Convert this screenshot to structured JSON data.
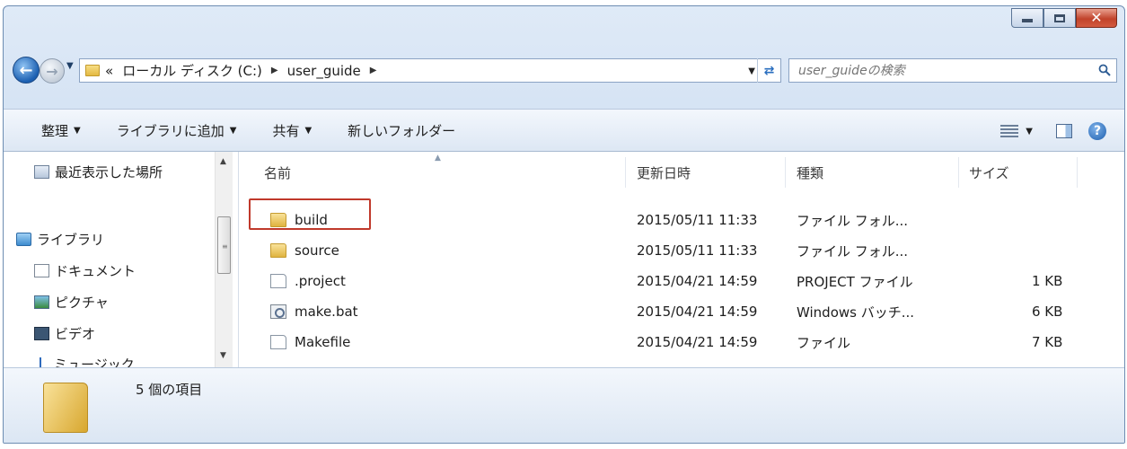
{
  "window": {
    "caption_close": "✕"
  },
  "address": {
    "prefix": "«",
    "crumbs": [
      "ローカル ディスク (C:)",
      "user_guide"
    ]
  },
  "search": {
    "placeholder": "user_guideの検索"
  },
  "toolbar": {
    "organize": "整理",
    "add_to_library": "ライブラリに追加",
    "share": "共有",
    "new_folder": "新しいフォルダー"
  },
  "nav": {
    "recent": "最近表示した場所",
    "library": "ライブラリ",
    "documents": "ドキュメント",
    "pictures": "ピクチャ",
    "videos": "ビデオ",
    "music": "ミュージック"
  },
  "columns": {
    "name": "名前",
    "modified": "更新日時",
    "type": "種類",
    "size": "サイズ"
  },
  "files": [
    {
      "name": "build",
      "modified": "2015/05/11 11:33",
      "type": "ファイル フォル...",
      "size": "",
      "icon": "folder-icon"
    },
    {
      "name": "source",
      "modified": "2015/05/11 11:33",
      "type": "ファイル フォル...",
      "size": "",
      "icon": "folder-icon"
    },
    {
      "name": ".project",
      "modified": "2015/04/21 14:59",
      "type": "PROJECT ファイル",
      "size": "1 KB",
      "icon": "file-icon"
    },
    {
      "name": "make.bat",
      "modified": "2015/04/21 14:59",
      "type": "Windows バッチ...",
      "size": "6 KB",
      "icon": "batch-file-icon"
    },
    {
      "name": "Makefile",
      "modified": "2015/04/21 14:59",
      "type": "ファイル",
      "size": "7 KB",
      "icon": "file-icon"
    }
  ],
  "status": {
    "item_count": "5 個の項目"
  },
  "colors": {
    "highlight_border": "#c0392b",
    "toolbar_bg": "#dde7f4",
    "window_frame": "#c7d9ef"
  }
}
